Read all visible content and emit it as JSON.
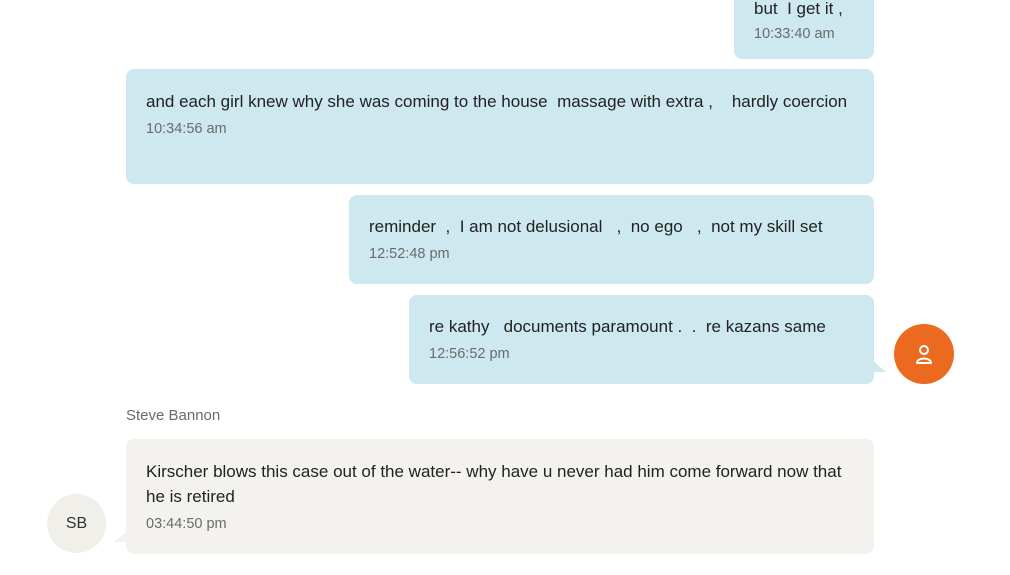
{
  "messages": [
    {
      "direction": "outgoing",
      "text": "but  I get it ,",
      "time": "10:33:40 am"
    },
    {
      "direction": "outgoing",
      "text": "and each girl knew why she was coming to the house  massage with extra ,    hardly coercion",
      "time": "10:34:56 am"
    },
    {
      "direction": "outgoing",
      "text": "reminder  ,  I am not delusional   ,  no ego   ,  not my skill set",
      "time": "12:52:48 pm"
    },
    {
      "direction": "outgoing",
      "text": "re kathy   documents paramount .  .  re kazans same",
      "time": "12:56:52 pm"
    },
    {
      "direction": "incoming",
      "sender": "Steve Bannon",
      "text": "Kirscher blows this case out of the water-- why have u never had him come forward now that he is retired",
      "time": "03:44:50 pm"
    }
  ],
  "avatars": {
    "self_icon": "person-icon",
    "self_color": "#ec6a20",
    "contact_initials": "SB"
  },
  "colors": {
    "outgoing_bubble": "#cde8ef",
    "incoming_bubble": "#f3f2ee",
    "timestamp": "#6b6b6b"
  }
}
